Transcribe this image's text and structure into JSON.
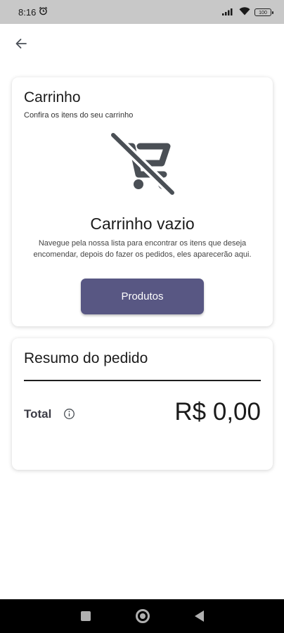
{
  "status_bar": {
    "time": "8:16",
    "alarm_icon": "alarm-icon",
    "signal_icon": "signal-icon",
    "wifi_icon": "wifi-icon",
    "battery_label": "100"
  },
  "header": {
    "back_icon": "arrow-left-icon"
  },
  "cart": {
    "title": "Carrinho",
    "subtitle": "Confira os itens do seu carrinho",
    "empty_icon": "cart-off-icon",
    "empty_title": "Carrinho vazio",
    "empty_description": "Navegue pela nossa lista para encontrar os itens que deseja encomendar, depois do fazer os pedidos, eles aparecerão aqui.",
    "products_button_label": "Produtos"
  },
  "summary": {
    "title": "Resumo do pedido",
    "total_label": "Total",
    "info_icon": "info-icon",
    "total_value": "R$ 0,00"
  },
  "nav_bar": {
    "recents_icon": "square-icon",
    "home_icon": "circle-icon",
    "back_icon": "triangle-back-icon"
  },
  "colors": {
    "accent": "#585783",
    "status_bar_bg": "#c8c8c8",
    "nav_bar_bg": "#000000",
    "icon_gray": "#4a4f55"
  }
}
